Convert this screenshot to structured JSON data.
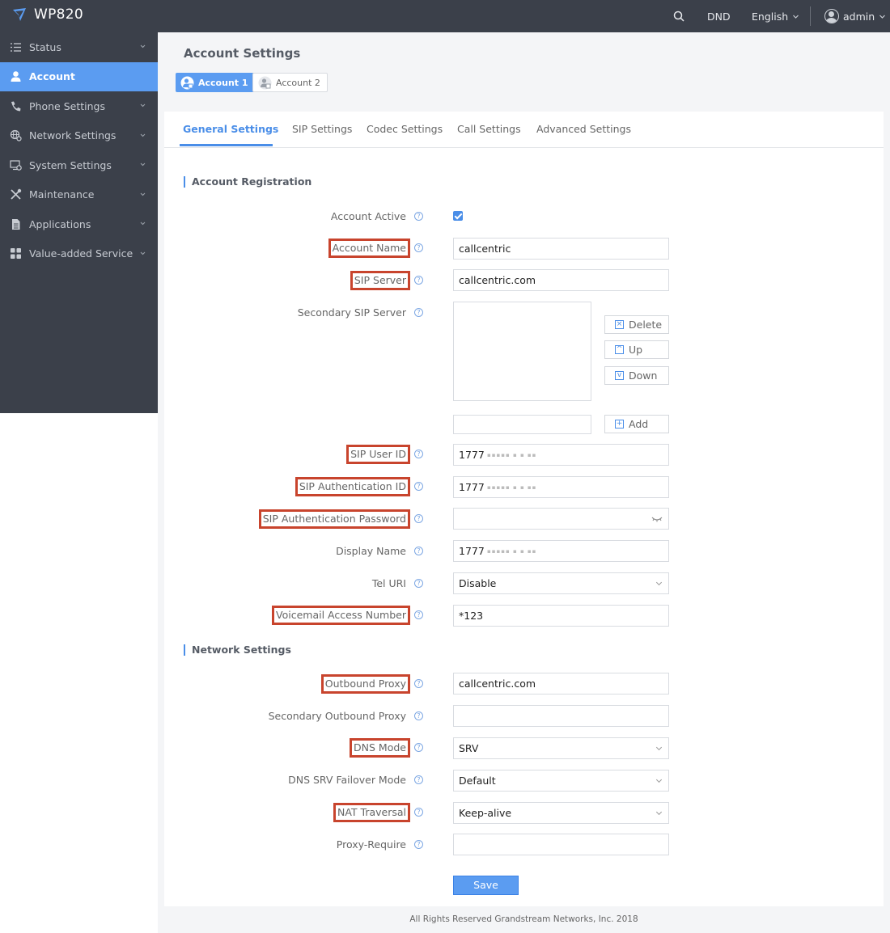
{
  "topbar": {
    "brand": "WP820",
    "dnd": "DND",
    "language": "English",
    "user": "admin"
  },
  "sidebar": {
    "items": [
      {
        "label": "Status",
        "icon": "list-icon"
      },
      {
        "label": "Account",
        "icon": "user-icon"
      },
      {
        "label": "Phone Settings",
        "icon": "phone-icon"
      },
      {
        "label": "Network Settings",
        "icon": "network-icon"
      },
      {
        "label": "System Settings",
        "icon": "monitor-gear-icon"
      },
      {
        "label": "Maintenance",
        "icon": "tools-icon"
      },
      {
        "label": "Applications",
        "icon": "document-icon"
      },
      {
        "label": "Value-added Service",
        "icon": "grid-icon"
      }
    ],
    "active_index": 1
  },
  "page": {
    "title": "Account Settings",
    "accounts": [
      "Account 1",
      "Account 2"
    ],
    "tabs": [
      "General Settings",
      "SIP Settings",
      "Codec Settings",
      "Call Settings",
      "Advanced Settings"
    ],
    "active_tab": 0
  },
  "sections": {
    "registration": "Account Registration",
    "network": "Network Settings"
  },
  "form": {
    "account_active": {
      "label": "Account Active",
      "checked": true
    },
    "account_name": {
      "label": "Account Name",
      "value": "callcentric"
    },
    "sip_server": {
      "label": "SIP Server",
      "value": "callcentric.com"
    },
    "secondary_sip_server": {
      "label": "Secondary SIP Server",
      "delete": "Delete",
      "up": "Up",
      "down": "Down",
      "add": "Add"
    },
    "sip_user_id": {
      "label": "SIP User ID",
      "value": "1777"
    },
    "sip_auth_id": {
      "label": "SIP Authentication ID",
      "value": "1777"
    },
    "sip_auth_password": {
      "label": "SIP Authentication Password",
      "value": ""
    },
    "display_name": {
      "label": "Display Name",
      "value": "1777"
    },
    "tel_uri": {
      "label": "Tel URI",
      "value": "Disable"
    },
    "voicemail": {
      "label": "Voicemail Access Number",
      "value": "*123"
    },
    "outbound_proxy": {
      "label": "Outbound Proxy",
      "value": "callcentric.com"
    },
    "secondary_outbound_proxy": {
      "label": "Secondary Outbound Proxy",
      "value": ""
    },
    "dns_mode": {
      "label": "DNS Mode",
      "value": "SRV"
    },
    "dns_srv_failover": {
      "label": "DNS SRV Failover Mode",
      "value": "Default"
    },
    "nat_traversal": {
      "label": "NAT Traversal",
      "value": "Keep-alive"
    },
    "proxy_require": {
      "label": "Proxy-Require",
      "value": ""
    },
    "save": "Save"
  },
  "footer": "All Rights Reserved Grandstream Networks, Inc. 2018",
  "colors": {
    "accent": "#5b9cf1",
    "sidebar": "#3b404a",
    "highlight": "#c8442d"
  }
}
